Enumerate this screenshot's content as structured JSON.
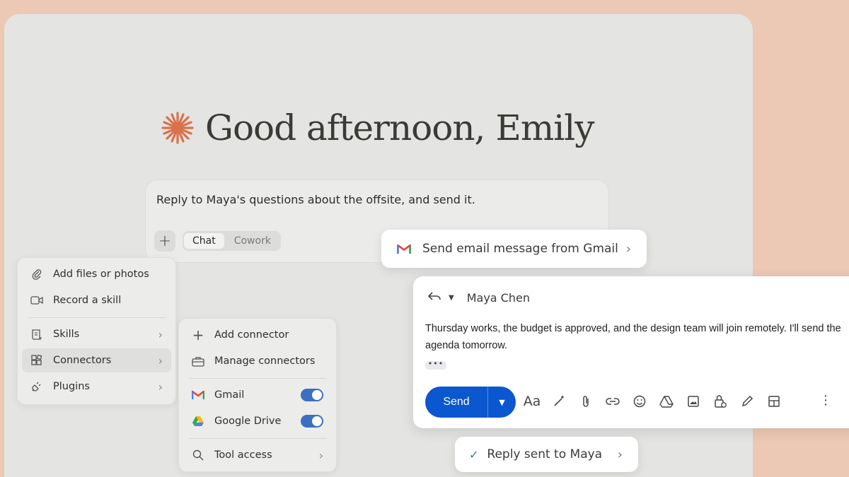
{
  "greeting": "Good afternoon, Emily",
  "composer": {
    "prompt": "Reply to Maya's questions about the offsite, and send it.",
    "modes": [
      "Chat",
      "Cowork"
    ],
    "active_mode": "Chat"
  },
  "menu_main": {
    "items": [
      {
        "label": "Add files or photos",
        "icon": "paperclip-icon"
      },
      {
        "label": "Record a skill",
        "icon": "video-icon"
      },
      {
        "label": "Skills",
        "icon": "scroll-icon"
      },
      {
        "label": "Connectors",
        "icon": "grid-icon"
      },
      {
        "label": "Plugins",
        "icon": "plug-icon"
      }
    ]
  },
  "menu_connectors": {
    "items": [
      {
        "label": "Add connector",
        "icon": "plus-icon"
      },
      {
        "label": "Manage connectors",
        "icon": "briefcase-icon"
      },
      {
        "label": "Gmail",
        "icon": "gmail-icon",
        "enabled": true
      },
      {
        "label": "Google Drive",
        "icon": "google-drive-icon",
        "enabled": true
      },
      {
        "label": "Tool access",
        "icon": "search-icon"
      }
    ]
  },
  "gmail_action": "Send email message from Gmail",
  "email": {
    "recipient": "Maya Chen",
    "body": "Thursday works, the budget is approved, and the design team will join remotely. I'll send the agenda tomorrow.",
    "send_label": "Send",
    "format_label": "Aa"
  },
  "status": "Reply sent to Maya",
  "colors": {
    "background": "#ecc9b5",
    "accent_spark": "#d9714a",
    "send_blue": "#0b57d0",
    "toggle_blue": "#3c6fc4"
  }
}
